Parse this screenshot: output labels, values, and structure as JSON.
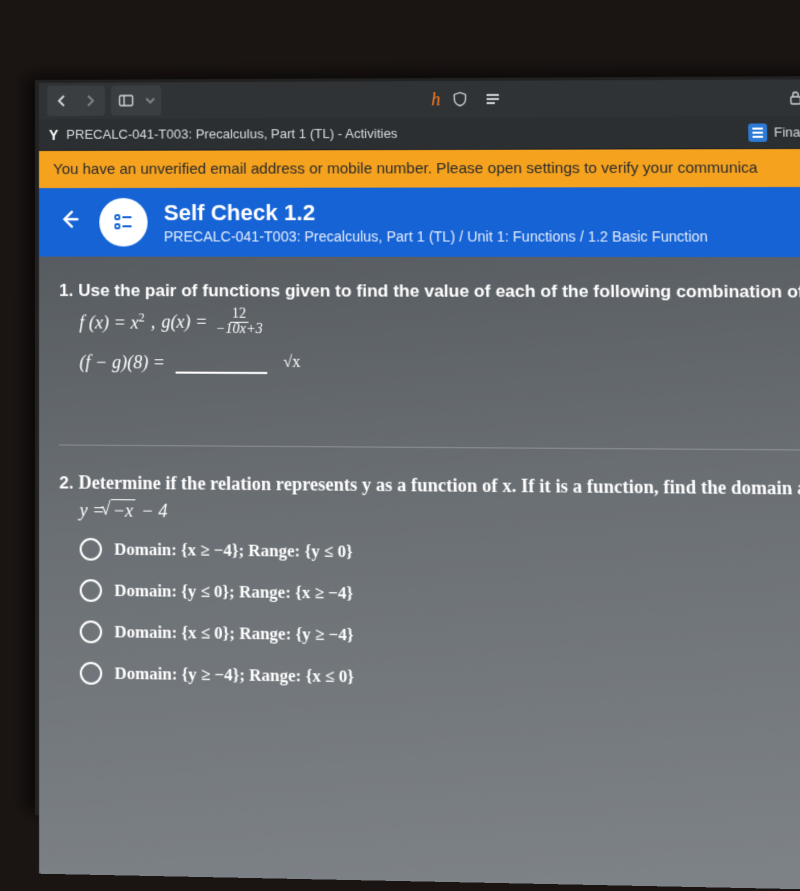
{
  "toolbar": {
    "honey_label": "h"
  },
  "tab": {
    "byu_logo": "Y",
    "title": "PRECALC-041-T003: Precalculus, Part 1 (TL) - Activities",
    "right_label": "Finan"
  },
  "banner": {
    "text": "You have an unverified email address or mobile number. Please open settings to verify your communica"
  },
  "header": {
    "title": "Self Check 1.2",
    "breadcrumb": "PRECALC-041-T003: Precalculus, Part 1 (TL) / Unit 1: Functions / 1.2 Basic Function"
  },
  "q1": {
    "number": "1.",
    "prompt": "Use the pair of functions given to find the value of each of the following combination of functions.",
    "f_lhs": "f (x) = x",
    "f_exp": "2",
    "comma": ",  ",
    "g_lhs": "g(x) = ",
    "frac_num": "12",
    "frac_den": "−10x+3",
    "expr": "(f − g)(8) =",
    "sqrt_btn": "√x"
  },
  "q2": {
    "number": "2.",
    "prompt": "Determine if the relation represents y as a function of x. If it is a function, find the domain and rang",
    "equation_pre": "y = ",
    "equation_rad": "−x",
    "equation_post": " − 4",
    "options": [
      "Domain: {x ≥ −4}; Range: {y ≤ 0}",
      "Domain: {y ≤ 0}; Range: {x ≥ −4}",
      "Domain: {x ≤ 0}; Range: {y ≥ −4}",
      "Domain: {y ≥ −4}; Range: {x ≤ 0}"
    ]
  }
}
